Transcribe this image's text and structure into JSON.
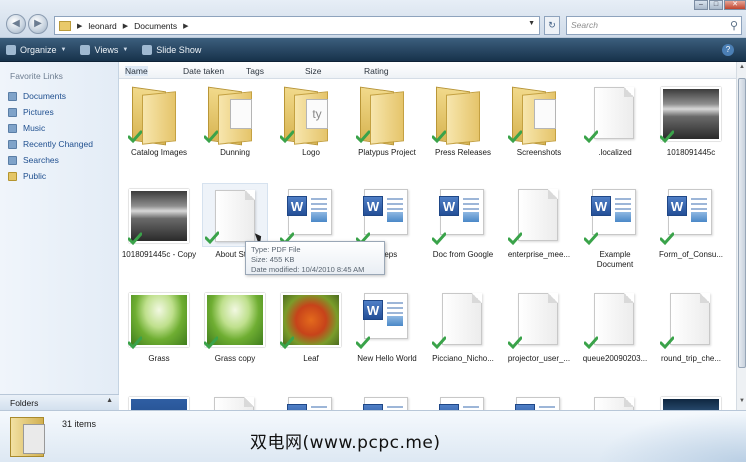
{
  "addressbar": {
    "breadcrumbs": [
      "leonard",
      "Documents"
    ],
    "search_placeholder": "Search"
  },
  "toolbar": {
    "organize": "Organize",
    "views": "Views",
    "slideshow": "Slide Show"
  },
  "navpane": {
    "heading": "Favorite Links",
    "items": [
      "Documents",
      "Pictures",
      "Music",
      "Recently Changed",
      "Searches",
      "Public"
    ],
    "folders_label": "Folders"
  },
  "columns": [
    "Name",
    "Date taken",
    "Tags",
    "Size",
    "Rating"
  ],
  "files": [
    {
      "name": "Catalog Images",
      "kind": "folder"
    },
    {
      "name": "Dunning",
      "kind": "folder"
    },
    {
      "name": "Logo",
      "kind": "folder"
    },
    {
      "name": "Platypus Project",
      "kind": "folder"
    },
    {
      "name": "Press Releases",
      "kind": "folder"
    },
    {
      "name": "Screenshots",
      "kind": "folder"
    },
    {
      "name": ".localized",
      "kind": "doc"
    },
    {
      "name": "1018091445c",
      "kind": "photo-room"
    },
    {
      "name": "1018091445c - Copy",
      "kind": "photo-room"
    },
    {
      "name": "About Stac",
      "kind": "doc"
    },
    {
      "name": "",
      "kind": "word"
    },
    {
      "name": "Steps",
      "kind": "word"
    },
    {
      "name": "Doc from Google",
      "kind": "word"
    },
    {
      "name": "enterprise_mee...",
      "kind": "doc"
    },
    {
      "name": "Example Document",
      "kind": "word"
    },
    {
      "name": "Form_of_Consu...",
      "kind": "word"
    },
    {
      "name": "Grass",
      "kind": "photo-grass"
    },
    {
      "name": "Grass copy",
      "kind": "photo-grass"
    },
    {
      "name": "Leaf",
      "kind": "photo-leaf"
    },
    {
      "name": "New Hello World",
      "kind": "word"
    },
    {
      "name": "Picciano_Nicho...",
      "kind": "doc"
    },
    {
      "name": "projector_user_...",
      "kind": "doc"
    },
    {
      "name": "queue20090203...",
      "kind": "doc"
    },
    {
      "name": "round_trip_che...",
      "kind": "doc"
    }
  ],
  "tooltip": {
    "type": "Type: PDF File",
    "size": "Size: 455 KB",
    "modified": "Date modified: 10/4/2010 8:45 AM"
  },
  "status": {
    "count": "31 items"
  },
  "watermark": "双电网(www.pcpc.me)"
}
